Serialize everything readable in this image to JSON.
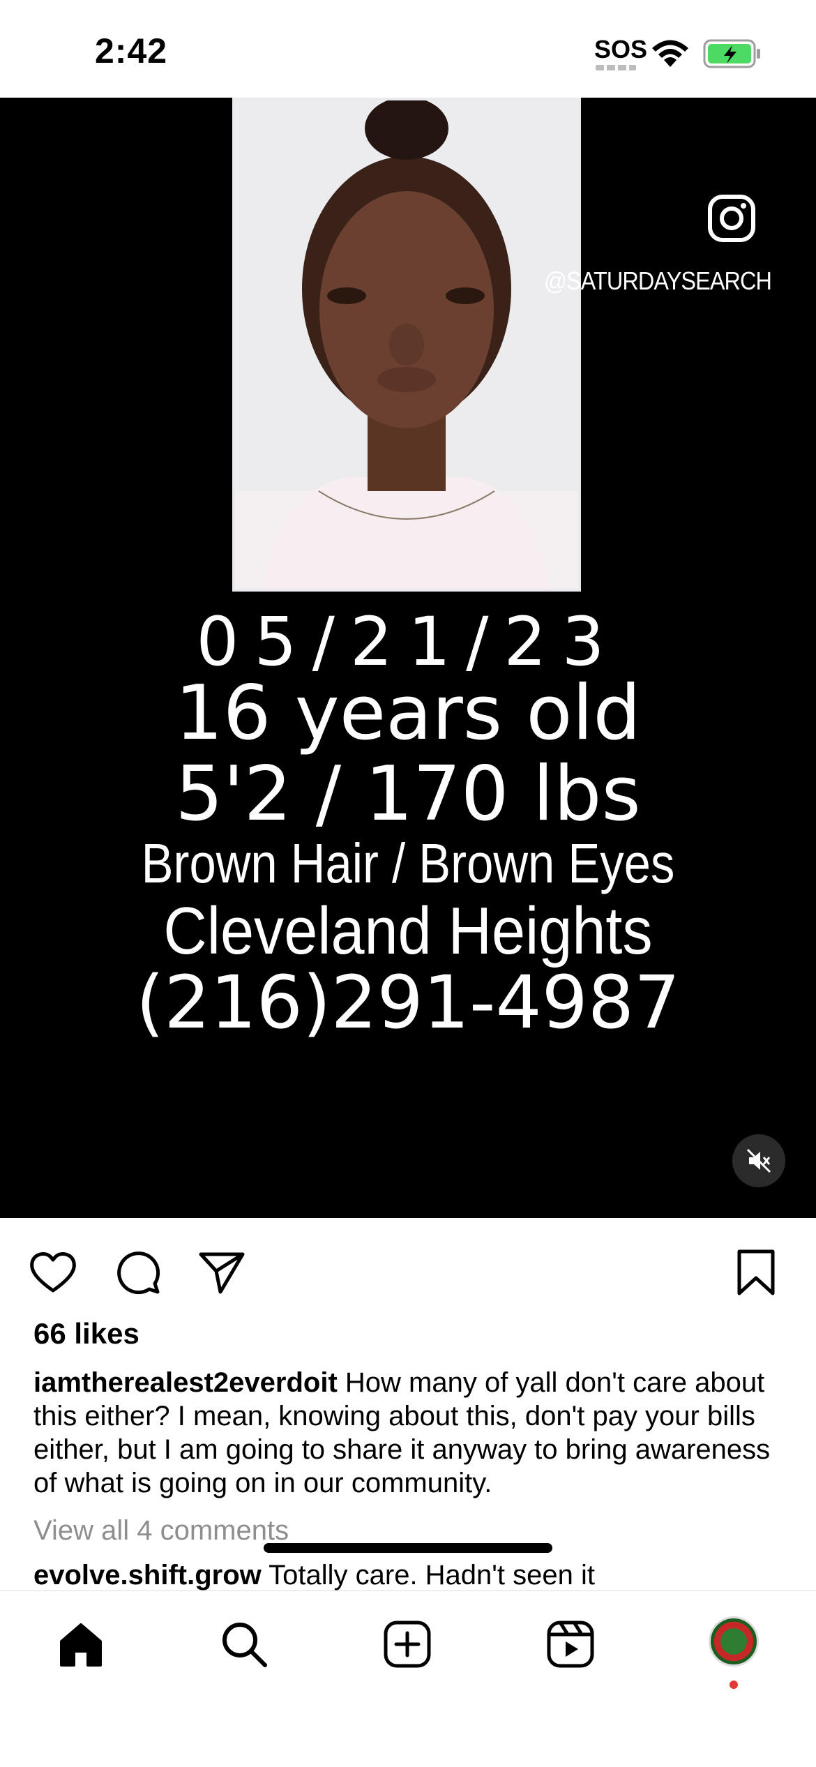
{
  "status_bar": {
    "time": "2:42",
    "sos": "SOS"
  },
  "post": {
    "watermark": "@SATURDAYSEARCH",
    "poster": {
      "date": "05/21/23",
      "age": "16 years old",
      "height_weight": "5'2 / 170 lbs",
      "hair_eyes": "Brown Hair / Brown Eyes",
      "city": "Cleveland Heights",
      "phone": "(216)291-4987"
    },
    "likes": "66 likes",
    "caption_user": "iamtherealest2everdoit",
    "caption_text": "How many of yall don't care about this either? I mean, knowing about this, don't pay your bills either, but I am going to share it anyway to bring awareness of what is going on in our community.",
    "view_comments": "View all 4 comments",
    "comment_user": "evolve.shift.grow",
    "comment_text": "Totally care. Hadn't seen it"
  },
  "icons": {
    "like": "heart-icon",
    "comment": "comment-icon",
    "share": "send-icon",
    "save": "bookmark-icon",
    "mute": "muted-speaker-icon",
    "home": "home-icon",
    "search": "search-icon",
    "create": "plus-square-icon",
    "reels": "reels-icon",
    "instagram": "instagram-icon"
  },
  "colors": {
    "battery": "#4cd964",
    "notification_dot": "#e53935",
    "muted_text": "#8e8e8e"
  }
}
